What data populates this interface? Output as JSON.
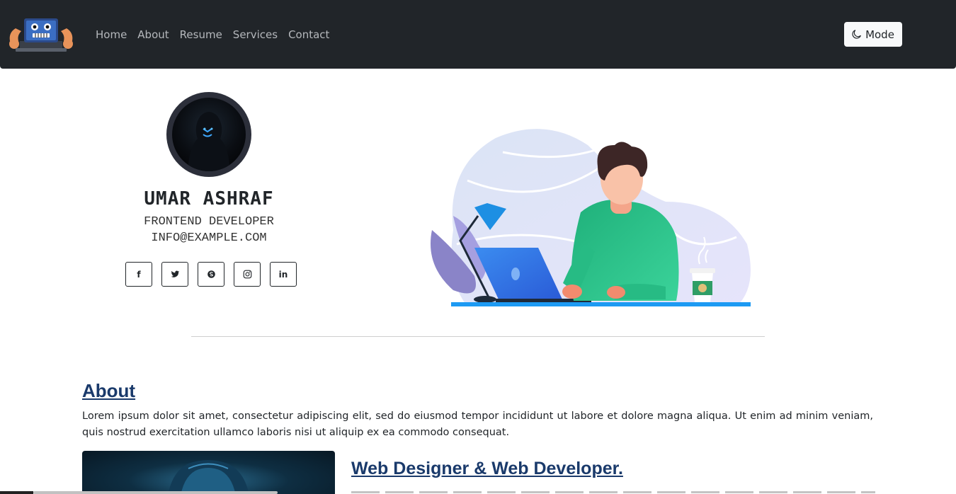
{
  "nav": {
    "links": [
      "Home",
      "About",
      "Resume",
      "Services",
      "Contact"
    ],
    "mode_label": "Mode"
  },
  "profile": {
    "name": "UMAR ASHRAF",
    "role": "FRONTEND DEVELOPER",
    "email": "INFO@EXAMPLE.COM",
    "socials": [
      {
        "icon": "facebook-icon",
        "glyph": "f"
      },
      {
        "icon": "twitter-icon",
        "glyph": ""
      },
      {
        "icon": "skype-icon",
        "glyph": ""
      },
      {
        "icon": "instagram-icon",
        "glyph": ""
      },
      {
        "icon": "linkedin-icon",
        "glyph": "in"
      }
    ]
  },
  "about": {
    "title": "About",
    "text": "Lorem ipsum dolor sit amet, consectetur adipiscing elit, sed do eiusmod tempor incididunt ut labore et dolore magna aliqua. Ut enim ad minim veniam, quis nostrud exercitation ullamco laboris nisi ut aliquip ex ea commodo consequat."
  },
  "subsection": {
    "title": "Web Designer & Web Developer."
  },
  "colors": {
    "navbar_bg": "#212529",
    "heading": "#1a3a6b",
    "accent_blue": "#2196f3",
    "shirt_green": "#2fc08a"
  }
}
